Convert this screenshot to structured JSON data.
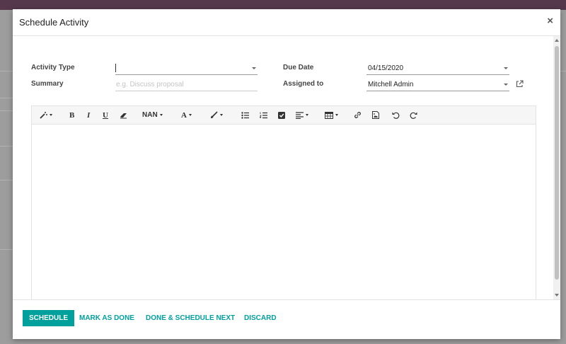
{
  "modal": {
    "title": "Schedule Activity",
    "close_glyph": "×"
  },
  "form": {
    "activity_type": {
      "label": "Activity Type",
      "value": ""
    },
    "summary": {
      "label": "Summary",
      "placeholder": "e.g. Discuss proposal"
    },
    "due_date": {
      "label": "Due Date",
      "value": "04/15/2020"
    },
    "assigned_to": {
      "label": "Assigned to",
      "value": "Mitchell Admin"
    }
  },
  "editor": {
    "toolbar": {
      "font_size_label": "NAN",
      "font_color_label": "A",
      "bold_label": "B",
      "italic_label": "I",
      "underline_label": "U"
    }
  },
  "footer": {
    "schedule_label": "SCHEDULE",
    "mark_done_label": "MARK AS DONE",
    "done_schedule_next_label": "DONE & SCHEDULE NEXT",
    "discard_label": "DISCARD"
  },
  "colors": {
    "accent": "#00a09d",
    "topbar": "#55384c"
  },
  "icons": [
    "magic-wand-icon",
    "eraser-icon",
    "paint-brush-icon",
    "unordered-list-icon",
    "ordered-list-icon",
    "checklist-icon",
    "align-icon",
    "table-icon",
    "link-icon",
    "image-icon",
    "undo-icon",
    "redo-icon",
    "external-link-icon",
    "close-icon"
  ]
}
